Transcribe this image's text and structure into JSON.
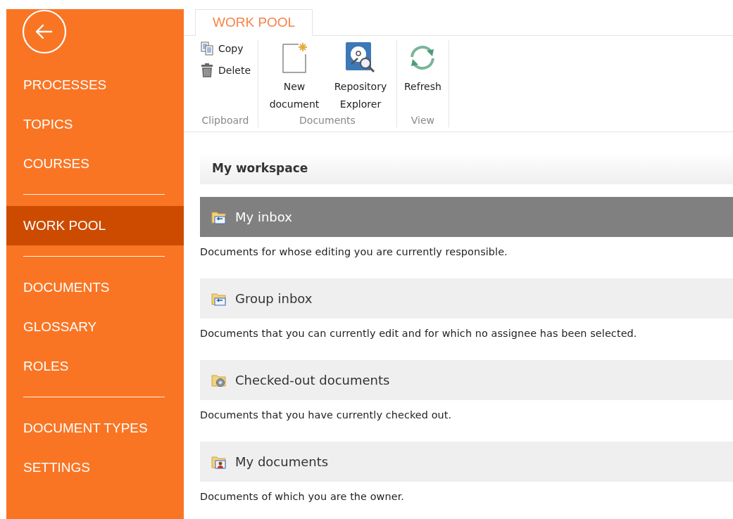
{
  "sidebar": {
    "items": [
      {
        "label": "PROCESSES",
        "selected": false,
        "divider_after": false
      },
      {
        "label": "TOPICS",
        "selected": false,
        "divider_after": false
      },
      {
        "label": "COURSES",
        "selected": false,
        "divider_after": true
      },
      {
        "label": "WORK POOL",
        "selected": true,
        "divider_after": true
      },
      {
        "label": "DOCUMENTS",
        "selected": false,
        "divider_after": false
      },
      {
        "label": "GLOSSARY",
        "selected": false,
        "divider_after": false
      },
      {
        "label": "ROLES",
        "selected": false,
        "divider_after": true
      },
      {
        "label": "DOCUMENT TYPES",
        "selected": false,
        "divider_after": false
      },
      {
        "label": "SETTINGS",
        "selected": false,
        "divider_after": false
      }
    ]
  },
  "ribbon": {
    "tab": "WORK POOL",
    "groups": [
      {
        "label": "Clipboard",
        "kind": "small",
        "buttons": [
          {
            "label": "Copy",
            "kind": "copy"
          },
          {
            "label": "Delete",
            "kind": "delete"
          }
        ]
      },
      {
        "label": "Documents",
        "kind": "large",
        "buttons": [
          {
            "label": "New document",
            "kind": "new"
          },
          {
            "label": "Repository Explorer",
            "kind": "repository"
          }
        ]
      },
      {
        "label": "View",
        "kind": "large",
        "buttons": [
          {
            "label": "Refresh",
            "kind": "refresh"
          }
        ]
      }
    ]
  },
  "workspace": {
    "title": "My workspace",
    "sections": [
      {
        "title": "My inbox",
        "kind": "inbox",
        "selected": true,
        "description": "Documents for whose editing you are currently responsible."
      },
      {
        "title": "Group inbox",
        "kind": "inbox",
        "selected": false,
        "description": "Documents that you can currently edit and for which no assignee has been selected."
      },
      {
        "title": "Checked-out documents",
        "kind": "checked-out",
        "selected": false,
        "description": "Documents that you have currently checked out."
      },
      {
        "title": "My documents",
        "kind": "owned",
        "selected": false,
        "description": "Documents of which you are the owner."
      }
    ]
  }
}
